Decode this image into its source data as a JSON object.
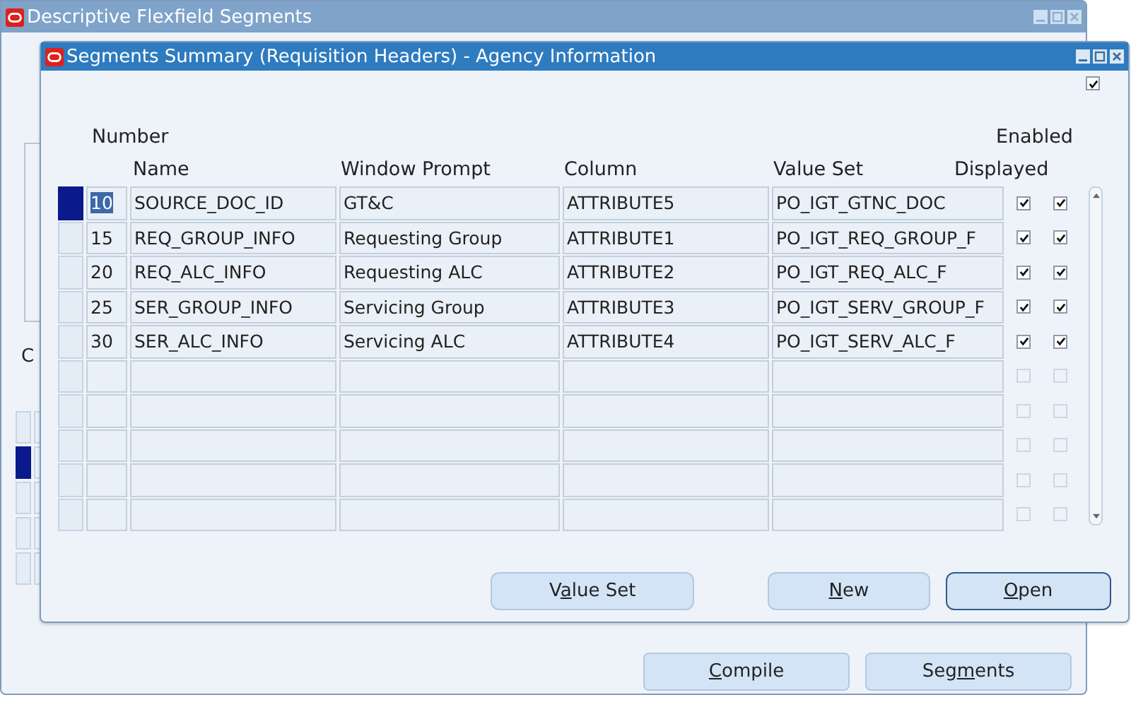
{
  "back_window": {
    "title": "Descriptive Flexfield Segments",
    "active": false,
    "fragments": [
      {
        "kind": "label",
        "text": "C"
      }
    ],
    "grid_rows": [
      {
        "selected": false
      },
      {
        "selected": true
      },
      {
        "selected": false
      },
      {
        "selected": false
      },
      {
        "selected": false
      }
    ],
    "buttons": [
      {
        "key": "C",
        "post": "ompile"
      },
      {
        "pre": "Seg",
        "key": "m",
        "post": "ents"
      }
    ]
  },
  "dialog": {
    "title": "Segments Summary (Requisition Headers) - Agency Information",
    "active": true,
    "top_checkbox": {
      "checked": true
    },
    "headers": {
      "number": "Number",
      "name": "Name",
      "window_prompt": "Window Prompt",
      "column": "Column",
      "value_set": "Value Set",
      "enabled": "Enabled",
      "displayed": "Displayed"
    },
    "rows": [
      {
        "kind": "segment",
        "selected": true,
        "number": "10",
        "name": "SOURCE_DOC_ID",
        "window_prompt": "GT&C",
        "column": "ATTRIBUTE5",
        "value_set": "PO_IGT_GTNC_DOC",
        "enabled": true,
        "displayed": true
      },
      {
        "kind": "segment",
        "selected": false,
        "number": "15",
        "name": "REQ_GROUP_INFO",
        "window_prompt": "Requesting Group",
        "column": "ATTRIBUTE1",
        "value_set": "PO_IGT_REQ_GROUP_F",
        "enabled": true,
        "displayed": true
      },
      {
        "kind": "segment",
        "selected": false,
        "number": "20",
        "name": "REQ_ALC_INFO",
        "window_prompt": "Requesting ALC",
        "column": "ATTRIBUTE2",
        "value_set": "PO_IGT_REQ_ALC_F",
        "enabled": true,
        "displayed": true
      },
      {
        "kind": "segment",
        "selected": false,
        "number": "25",
        "name": "SER_GROUP_INFO",
        "window_prompt": "Servicing Group",
        "column": "ATTRIBUTE3",
        "value_set": "PO_IGT_SERV_GROUP_F",
        "enabled": true,
        "displayed": true
      },
      {
        "kind": "segment",
        "selected": false,
        "number": "30",
        "name": "SER_ALC_INFO",
        "window_prompt": "Servicing ALC",
        "column": "ATTRIBUTE4",
        "value_set": "PO_IGT_SERV_ALC_F",
        "enabled": true,
        "displayed": true
      },
      {
        "kind": "blank",
        "selected": false,
        "enabled": false,
        "displayed": false
      },
      {
        "kind": "blank",
        "selected": false,
        "enabled": false,
        "displayed": false
      },
      {
        "kind": "blank",
        "selected": false,
        "enabled": false,
        "displayed": false
      },
      {
        "kind": "blank",
        "selected": false,
        "enabled": false,
        "displayed": false
      },
      {
        "kind": "blank",
        "selected": false,
        "enabled": false,
        "displayed": false
      }
    ],
    "buttons": [
      {
        "pre": "V",
        "key": "a",
        "post": "lue Set",
        "default": false
      },
      {
        "key": "N",
        "post": "ew",
        "default": false
      },
      {
        "key": "O",
        "post": "pen",
        "default": true
      }
    ]
  }
}
